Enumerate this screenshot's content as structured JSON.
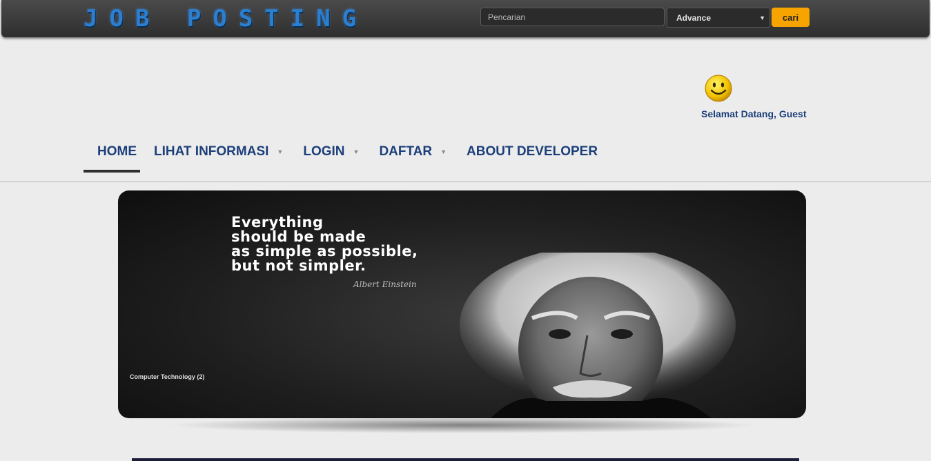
{
  "header": {
    "logo": "JOB POSTING",
    "search_placeholder": "Pencarian",
    "select_value": "Advance",
    "search_button": "cari"
  },
  "user": {
    "welcome": "Selamat Datang, Guest"
  },
  "nav": [
    {
      "label": "HOME",
      "active": true
    },
    {
      "label": "LIHAT INFORMASI"
    },
    {
      "label": "LOGIN"
    },
    {
      "label": "DAFTAR"
    },
    {
      "label": "ABOUT DEVELOPER"
    }
  ],
  "banner": {
    "quote_lines": [
      "Everything",
      "should be made",
      "as simple as possible,",
      "but not simpler."
    ],
    "author": "Albert Einstein",
    "caption": "Computer Technology (2)"
  },
  "colors": {
    "nav_text": "#1c3f7a",
    "search_button": "#f7a400",
    "logo": "#2a7fd0"
  }
}
